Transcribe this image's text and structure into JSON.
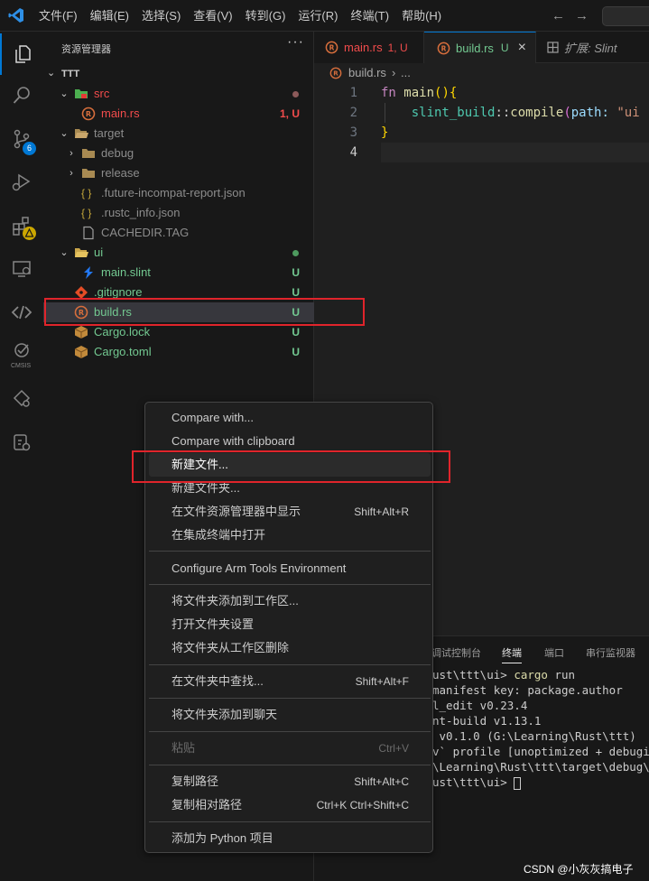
{
  "menubar": [
    "文件(F)",
    "编辑(E)",
    "选择(S)",
    "查看(V)",
    "转到(G)",
    "运行(R)",
    "终端(T)",
    "帮助(H)"
  ],
  "activity": {
    "scm_badge": "6",
    "cmsis_label": "CMSIS"
  },
  "explorer": {
    "title": "资源管理器",
    "more": "···",
    "root": "TTT",
    "tree": [
      {
        "name": "src",
        "status": "",
        "color": "#f14c4c"
      },
      {
        "name": "main.rs",
        "status": "1, U",
        "color": "#f14c4c"
      },
      {
        "name": "target",
        "status": "",
        "color": "#8c8c8c"
      },
      {
        "name": "debug",
        "status": "",
        "color": "#8c8c8c"
      },
      {
        "name": "release",
        "status": "",
        "color": "#8c8c8c"
      },
      {
        "name": ".future-incompat-report.json",
        "status": "",
        "color": "#8c8c8c"
      },
      {
        "name": ".rustc_info.json",
        "status": "",
        "color": "#8c8c8c"
      },
      {
        "name": "CACHEDIR.TAG",
        "status": "",
        "color": "#8c8c8c"
      },
      {
        "name": "ui",
        "status": "",
        "color": "#73c991"
      },
      {
        "name": "main.slint",
        "status": "U",
        "color": "#73c991"
      },
      {
        "name": ".gitignore",
        "status": "U",
        "color": "#73c991"
      },
      {
        "name": "build.rs",
        "status": "U",
        "color": "#73c991"
      },
      {
        "name": "Cargo.lock",
        "status": "U",
        "color": "#73c991"
      },
      {
        "name": "Cargo.toml",
        "status": "U",
        "color": "#73c991"
      }
    ]
  },
  "tabs": [
    {
      "name": "main.rs",
      "status": "1, U"
    },
    {
      "name": "build.rs",
      "status": "U",
      "close": "×"
    },
    {
      "name": "扩展: Slint"
    }
  ],
  "breadcrumb": {
    "file": "build.rs",
    "sep": "›",
    "rest": "..."
  },
  "editor": {
    "line_numbers": [
      "1",
      "2",
      "3",
      "4"
    ],
    "line1_kw": "fn",
    "line1_fn": "main",
    "line1_paren": "(){",
    "line2_mod": "slint_build",
    "line2_sep": "::",
    "line2_fn": "compile",
    "line2_open": "(",
    "line2_param": "path:",
    "line2_str": "\"ui",
    "line3": "}"
  },
  "panel": {
    "tabs": [
      "调试控制台",
      "终端",
      "端口",
      "串行监视器"
    ],
    "terminal": [
      {
        "prefix": "ust\\ttt\\ui> ",
        "cmd": "cargo",
        "arg": " run"
      },
      {
        "text": "manifest key: package.author"
      },
      {
        "text": "l_edit v0.23.4"
      },
      {
        "text": "nt-build v1.13.1"
      },
      {
        "text": " v0.1.0 (G:\\Learning\\Rust\\ttt)"
      },
      {
        "text": "v` profile [unoptimized + debuginf"
      },
      {
        "text": "\\Learning\\Rust\\ttt\\target\\debug\\tt"
      },
      {
        "prefix": "ust\\ttt\\ui> "
      }
    ]
  },
  "context_menu": {
    "items": [
      {
        "label": "Compare with..."
      },
      {
        "label": "Compare with clipboard"
      },
      {
        "label": "新建文件..."
      },
      {
        "label": "新建文件夹..."
      },
      {
        "label": "在文件资源管理器中显示",
        "shortcut": "Shift+Alt+R"
      },
      {
        "label": "在集成终端中打开"
      },
      {
        "label": "Configure Arm Tools Environment"
      },
      {
        "label": "将文件夹添加到工作区..."
      },
      {
        "label": "打开文件夹设置"
      },
      {
        "label": "将文件夹从工作区删除"
      },
      {
        "label": "在文件夹中查找...",
        "shortcut": "Shift+Alt+F"
      },
      {
        "label": "将文件夹添加到聊天"
      },
      {
        "label": "粘贴",
        "shortcut": "Ctrl+V"
      },
      {
        "label": "复制路径",
        "shortcut": "Shift+Alt+C"
      },
      {
        "label": "复制相对路径",
        "shortcut": "Ctrl+K Ctrl+Shift+C"
      },
      {
        "label": "添加为 Python 项目"
      }
    ]
  },
  "watermark": "CSDN @小灰灰搞电子",
  "colors": {
    "accent": "#0078d4",
    "highlight_box": "#e0242b",
    "untracked": "#73c991",
    "error": "#f14c4c"
  }
}
